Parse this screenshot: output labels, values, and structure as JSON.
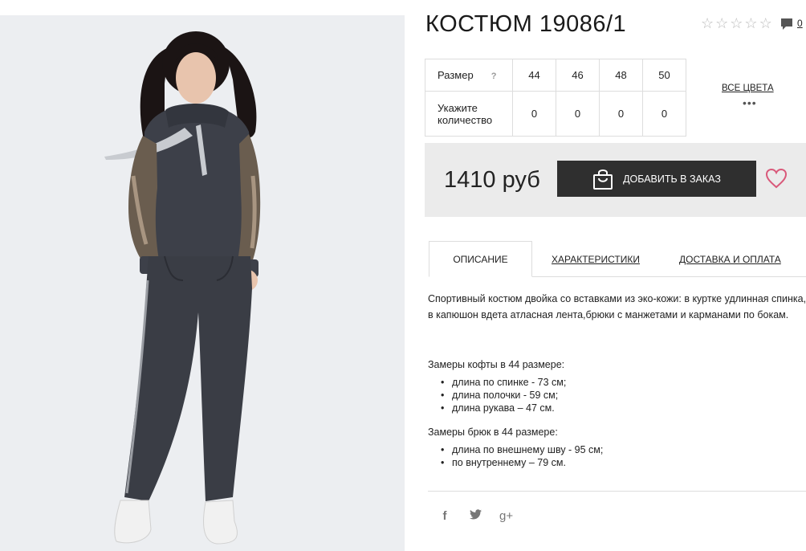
{
  "product": {
    "title": "КОСТЮМ 19086/1",
    "rating_stars": 0,
    "rating_max": 5,
    "comments_count": "0"
  },
  "sizes_table": {
    "size_label": "Размер",
    "help": "?",
    "qty_label_line1": "Укажите",
    "qty_label_line2": "количество",
    "sizes": [
      "44",
      "46",
      "48",
      "50"
    ],
    "quantities": [
      "0",
      "0",
      "0",
      "0"
    ]
  },
  "colors": {
    "all_colors_label": "ВСЕ ЦВЕТА",
    "more": "•••"
  },
  "purchase": {
    "price": "1410 руб",
    "add_button_label": "ДОБАВИТЬ В ЗАКАЗ",
    "accent_color": "#d9597a",
    "button_color": "#2f2f2f"
  },
  "tabs": [
    {
      "label": "ОПИСАНИЕ",
      "active": true
    },
    {
      "label": "ХАРАКТЕРИСТИКИ",
      "active": false
    },
    {
      "label": "ДОСТАВКА И ОПЛАТА",
      "active": false
    }
  ],
  "description": {
    "text": "Спортивный костюм двойка со вставками из эко-кожи: в куртке удлинная спинка, в капюшон вдета атласная лента,брюки с манжетами и карманами по бокам.",
    "top_title": "Замеры кофты в 44 размере:",
    "top_items": [
      "длина по спинке - 73 см;",
      "длина полочки - 59 см;",
      "длина рукава – 47 см."
    ],
    "pants_title": "Замеры брюк в 44 размере:",
    "pants_items": [
      "длина по внешнему шву - 95 см;",
      "по внутреннему – 79 см."
    ]
  },
  "social": {
    "facebook": "f",
    "twitter": "twitter-icon",
    "googleplus": "g+"
  }
}
